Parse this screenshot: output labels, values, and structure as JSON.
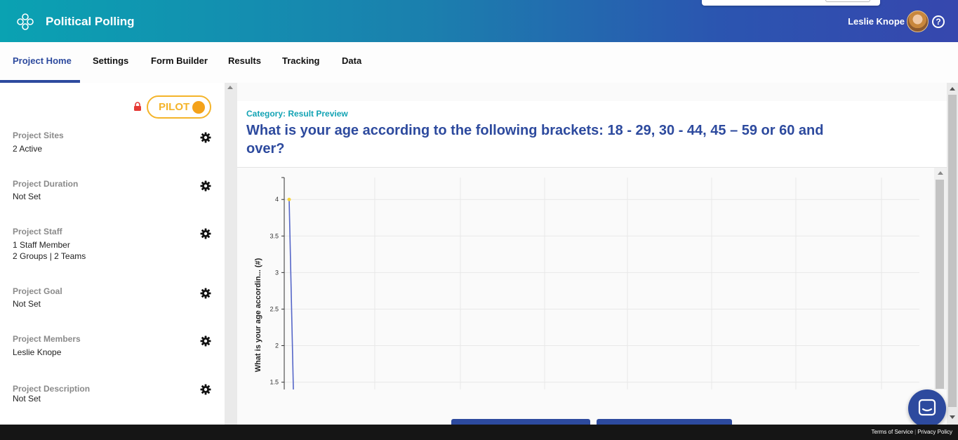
{
  "header": {
    "app_title": "Political Polling",
    "user_name": "Leslie Knope",
    "help_symbol": "?",
    "brand_color": "#2d4a9e"
  },
  "tabs": [
    {
      "label": "Project Home",
      "active": true
    },
    {
      "label": "Settings",
      "active": false
    },
    {
      "label": "Form Builder",
      "active": false
    },
    {
      "label": "Results",
      "active": false
    },
    {
      "label": "Tracking",
      "active": false
    },
    {
      "label": "Data",
      "active": false
    }
  ],
  "sidebar": {
    "pilot_label": "PILOT",
    "sections": [
      {
        "label": "Project Sites",
        "values": [
          "2 Active"
        ]
      },
      {
        "label": "Project Duration",
        "values": [
          "Not Set"
        ]
      },
      {
        "label": "Project Staff",
        "values": [
          "1 Staff Member",
          "2 Groups | 2 Teams"
        ]
      },
      {
        "label": "Project Goal",
        "values": [
          "Not Set"
        ]
      },
      {
        "label": "Project Members",
        "values": [
          "Leslie Knope"
        ]
      },
      {
        "label": "Project Description",
        "values": [
          "Not Set"
        ]
      }
    ]
  },
  "main": {
    "category": "Category: Result Preview",
    "question": "What is your age according to the following brackets: 18 - 29, 30 - 44, 45 – 59 or 60 and over?"
  },
  "chart_data": {
    "type": "line",
    "ylabel": "What is your age accordin... (#)",
    "yticks": [
      "4",
      "3.5",
      "3",
      "2.5",
      "2",
      "1.5"
    ],
    "ylim": [
      1.4,
      4.3
    ],
    "grid": true,
    "series": [
      {
        "color": "#5566c8",
        "points": [
          {
            "x": 0,
            "y": 4
          },
          {
            "x": 0.06,
            "y": 1.4
          }
        ]
      }
    ]
  },
  "footer": {
    "terms": "Terms of Service",
    "privacy": "Privacy Policy"
  }
}
